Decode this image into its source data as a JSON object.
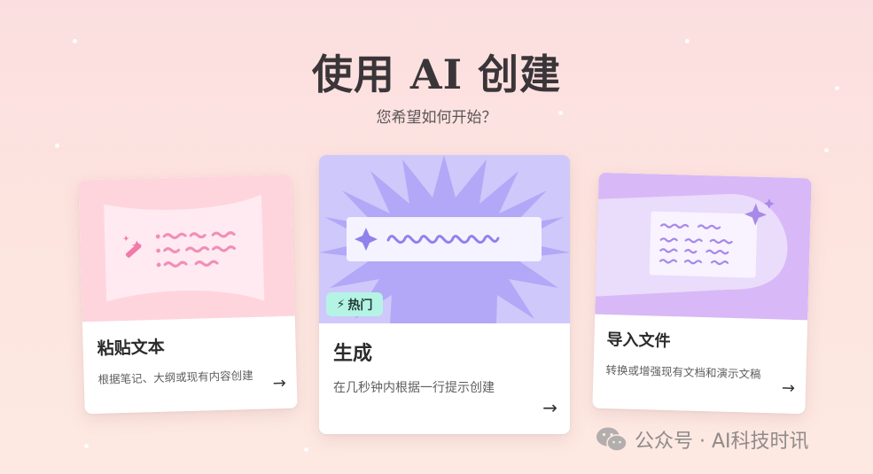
{
  "header": {
    "title": "使用 AI 创建",
    "subtitle": "您希望如何开始？"
  },
  "cards": {
    "paste": {
      "title": "粘贴文本",
      "description": "根据笔记、大纲或现有内容创建",
      "icon": "magic-wand-icon"
    },
    "generate": {
      "title": "生成",
      "description": "在几秒钟内根据一行提示创建",
      "badge": "热门",
      "badge_icon": "lightning-icon"
    },
    "import": {
      "title": "导入文件",
      "description": "转换或增强现有文档和演示文稿",
      "icon": "sparkle-icon"
    }
  },
  "watermark": {
    "text": "公众号 · AI科技时讯",
    "icon": "wechat-icon"
  },
  "colors": {
    "paste_accent": "#ffd5dd",
    "generate_accent": "#cfc8fb",
    "import_accent": "#d8b8f6",
    "badge_bg": "#b5f3e4"
  }
}
